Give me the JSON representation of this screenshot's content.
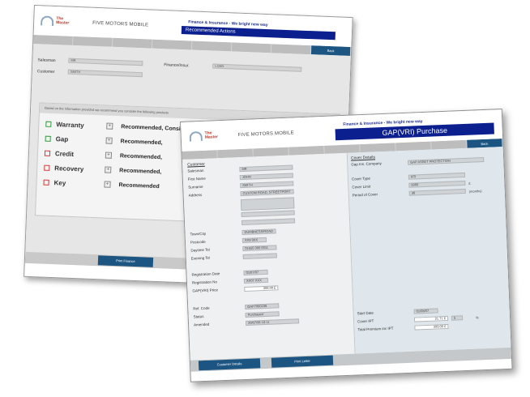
{
  "back_window": {
    "logo_top": "The",
    "logo_bottom": "Master",
    "brand": "FIVE MOTORS MOBILE",
    "header_link": "Finance & Insurance - We bright new way",
    "header_bar": "Recommended Actions",
    "tabs": [
      "",
      "",
      "",
      "",
      "",
      "",
      "",
      "Back"
    ],
    "fields": {
      "salesman_label": "Salesman",
      "salesman_value": "MR",
      "customer_label": "Customer",
      "customer_value": "SMITH",
      "finance_label": "Finance/Insur.",
      "finance_value": "LOAN"
    },
    "panel_heading": "Based on the information provided we recommend you consider the following products",
    "products": [
      {
        "name": "Warranty",
        "status": "green",
        "rec": "Recommended, Considered and Purchased"
      },
      {
        "name": "Gap",
        "status": "green",
        "rec": "Recommended,"
      },
      {
        "name": "Credit",
        "status": "red",
        "rec": "Recommended,"
      },
      {
        "name": "Recovery",
        "status": "red",
        "rec": "Recommended,"
      },
      {
        "name": "Key",
        "status": "red",
        "rec": "Recommended"
      }
    ],
    "footer_button": "Print Finance"
  },
  "front_window": {
    "logo_top": "The",
    "logo_bottom": "Master",
    "brand": "FIVE MOTORS MOBILE",
    "header_link": "Finance & Insurance - We bright new way",
    "header_bar": "GAP(VRI) Purchase",
    "tabs": [
      "",
      "",
      "",
      "",
      "",
      "",
      "",
      "",
      "Back"
    ],
    "customer": {
      "title": "Customer",
      "salesman_label": "Salesman",
      "salesman_value": "MR",
      "first_name_label": "First Name",
      "first_name_value": "JOHN",
      "surname_label": "Surname",
      "surname_value": "SMITH",
      "address_label": "Address",
      "address_value": "CUSTOM ROAD, STREETPORT",
      "town_label": "Town/City",
      "town_value": "DUMBNESS/ROAD",
      "postcode_label": "Postcode",
      "postcode_value": "XX9 9XX",
      "daytime_label": "Daytime Tel",
      "daytime_value": "01555 000 0011",
      "evening_label": "Evening Tel",
      "evening_value": "",
      "reg_date_label": "Registration Date",
      "reg_date_value": "01/07/07",
      "reg_no_label": "Registration No",
      "reg_no_value": "XX07 XXX",
      "price_label": "GAP(VRI) Price",
      "price_value": "399.00 £",
      "ref_label": "Ref. Code",
      "ref_value": "GAP7000236",
      "status_label": "Status",
      "status_value": "Purchased",
      "amended_label": "Amended",
      "amended_value": "20/07/08 10:11"
    },
    "cover": {
      "title": "Cover Details",
      "ins_company_label": "Gap Ins. Company",
      "ins_company_value": "GAP ASSET PROTECTION",
      "cover_type_label": "Cover Type",
      "cover_type_value": "RTI",
      "cover_limit_label": "Cover Limit",
      "cover_limit_value": "5000",
      "cover_limit_unit": "£",
      "period_label": "Period of Cover",
      "period_value": "36",
      "period_unit": "(months)",
      "start_label": "Start Date",
      "start_value": "01/08/07",
      "ipt_label": "Cover IPT",
      "ipt_value": "21.71 £",
      "ipt_pct": "5",
      "ipt_unit": "%",
      "total_label": "Total Premium inc IPT",
      "total_value": "399.00 £"
    },
    "footer_buttons": [
      "Customer Details",
      "Print Letter"
    ]
  }
}
